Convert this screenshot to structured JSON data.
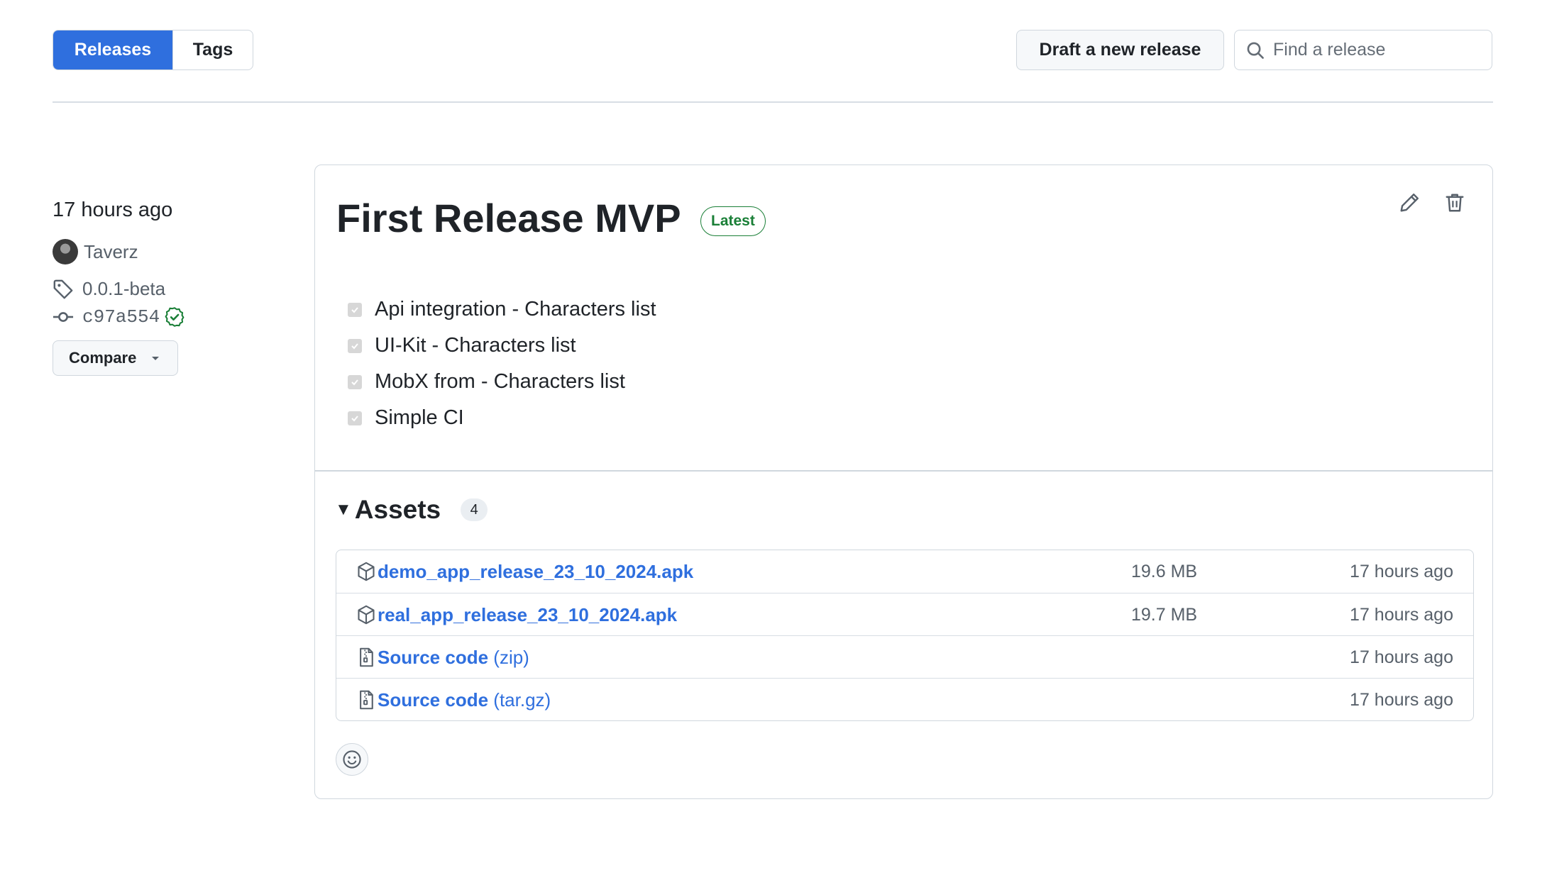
{
  "tabs": {
    "releases_label": "Releases",
    "tags_label": "Tags"
  },
  "toolbar": {
    "draft_label": "Draft a new release",
    "search_placeholder": "Find a release"
  },
  "release_meta": {
    "time": "17 hours ago",
    "author": "Taverz",
    "tag": "0.0.1-beta",
    "commit": "c97a554",
    "compare_label": "Compare"
  },
  "release": {
    "title": "First Release MVP",
    "badge": "Latest",
    "notes": [
      {
        "text": "Api integration - Characters list",
        "checked": true
      },
      {
        "text": "UI-Kit - Characters list",
        "checked": true
      },
      {
        "text": "MobX from - Characters list",
        "checked": true
      },
      {
        "text": "Simple CI",
        "checked": true
      }
    ]
  },
  "assets": {
    "title": "Assets",
    "count": "4",
    "rows": [
      {
        "icon": "package-icon",
        "name": "demo_app_release_23_10_2024.apk",
        "suffix": "",
        "size": "19.6 MB",
        "time": "17 hours ago"
      },
      {
        "icon": "package-icon",
        "name": "real_app_release_23_10_2024.apk",
        "suffix": "",
        "size": "19.7 MB",
        "time": "17 hours ago"
      },
      {
        "icon": "file-zip-icon",
        "name": "Source code",
        "suffix": " (zip)",
        "size": "",
        "time": "17 hours ago"
      },
      {
        "icon": "file-zip-icon",
        "name": "Source code",
        "suffix": " (tar.gz)",
        "size": "",
        "time": "17 hours ago"
      }
    ]
  },
  "colors": {
    "accent": "#2f6fde",
    "success": "#1a7f37",
    "border": "#d0d7de",
    "muted_text": "#57606a"
  }
}
